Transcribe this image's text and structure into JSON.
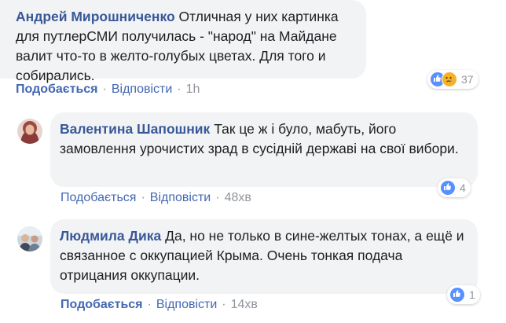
{
  "actions": {
    "like_label": "Подобається",
    "reply_label": "Відповісти",
    "separator": "·"
  },
  "comments": [
    {
      "author": "Андрей Мирошниченко",
      "text": "Отличная у них картинка для путлерСМИ получилась - \"народ\" на Майдане валит что-то в желто-голубых цветах. Для того и собирались.",
      "time": "1h",
      "reactions": {
        "icons": [
          "like-icon",
          "sad-icon"
        ],
        "count": "37"
      }
    },
    {
      "author": "Валентина Шапошник",
      "text": "Так це ж і було, мабуть, його замовлення урочистих зрад в сусідній державі на свої вибори.",
      "time": "48хв",
      "reactions": {
        "icons": [
          "like-icon"
        ],
        "count": "4"
      }
    },
    {
      "author": "Людмила Дика",
      "text": "Да, но не только в сине-желтых тонах, а ещё и связанное с оккупацией Крыма. Очень тонкая подача отрицания оккупации.",
      "time": "14хв",
      "reactions": {
        "icons": [
          "like-icon"
        ],
        "count": "1"
      }
    }
  ],
  "colors": {
    "link": "#4267b2",
    "author": "#385898",
    "meta": "#90949c",
    "bubble": "#f2f3f5",
    "like_reaction": "#5890ff",
    "sad_reaction": "#f7b125"
  }
}
